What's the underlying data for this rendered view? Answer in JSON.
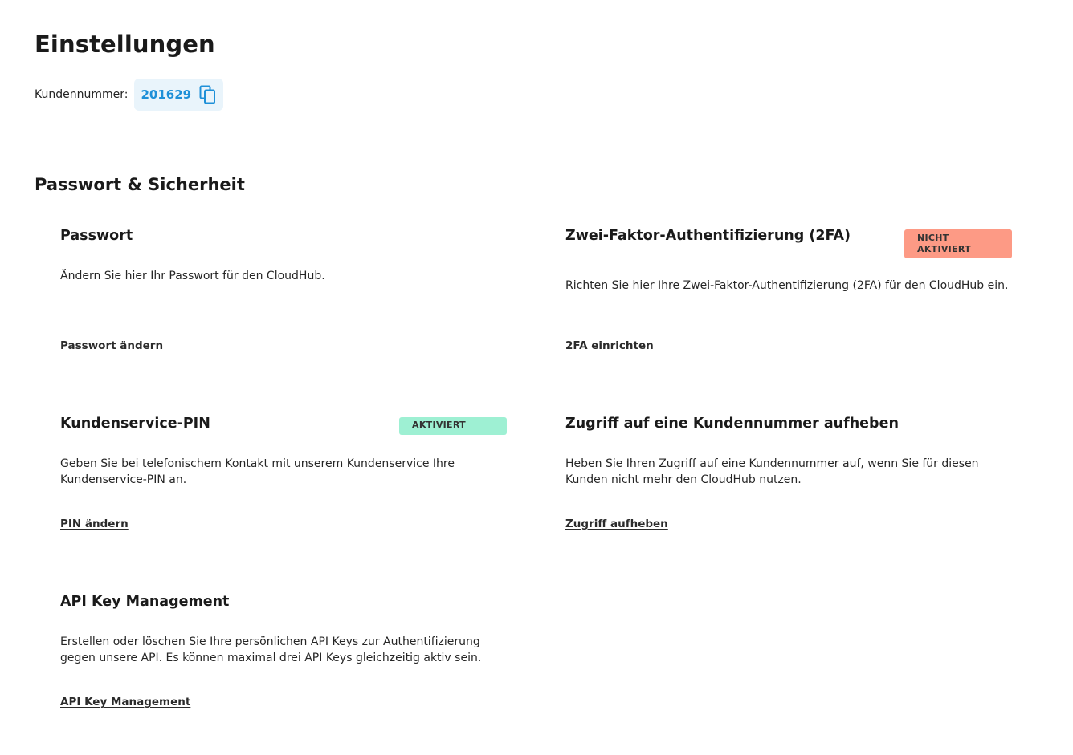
{
  "page": {
    "title": "Einstellungen",
    "customer_label": "Kundennummer:",
    "customer_number": "201629",
    "copy_icon": "copy-icon"
  },
  "section": {
    "title": "Passwort & Sicherheit"
  },
  "cards": {
    "password": {
      "title": "Passwort",
      "description": "Ändern Sie hier Ihr Passwort für den CloudHub.",
      "link": "Passwort ändern"
    },
    "twofa": {
      "title": "Zwei-Faktor-Authentifizierung (2FA)",
      "badge_line1": "NICHT",
      "badge_line2": "AKTIVIERT",
      "badge_color": "#fd9a85",
      "description": "Richten Sie hier Ihre Zwei-Faktor-Authentifizierung (2FA) für den CloudHub ein.",
      "link": "2FA einrichten"
    },
    "pin": {
      "title": "Kundenservice-PIN",
      "badge": "AKTIVIERT",
      "badge_color": "#9ef0d3",
      "description": "Geben Sie bei telefonischem Kontakt mit unserem Kundenservice Ihre Kundenservice-PIN an.",
      "link": "PIN ändern"
    },
    "access": {
      "title": "Zugriff auf eine Kundennummer aufheben",
      "description": "Heben Sie Ihren Zugriff auf eine Kundennummer auf, wenn Sie für diesen Kunden nicht mehr den CloudHub nutzen.",
      "link": "Zugriff aufheben"
    },
    "api": {
      "title": "API Key Management",
      "description": "Erstellen oder löschen Sie Ihre persönlichen API Keys zur Authentifizierung gegen unsere API. Es können maximal drei API Keys gleichzeitig aktiv sein.",
      "link": "API Key Management"
    }
  },
  "colors": {
    "accent": "#1e90d8",
    "chip_background": "#e9f4fb"
  }
}
